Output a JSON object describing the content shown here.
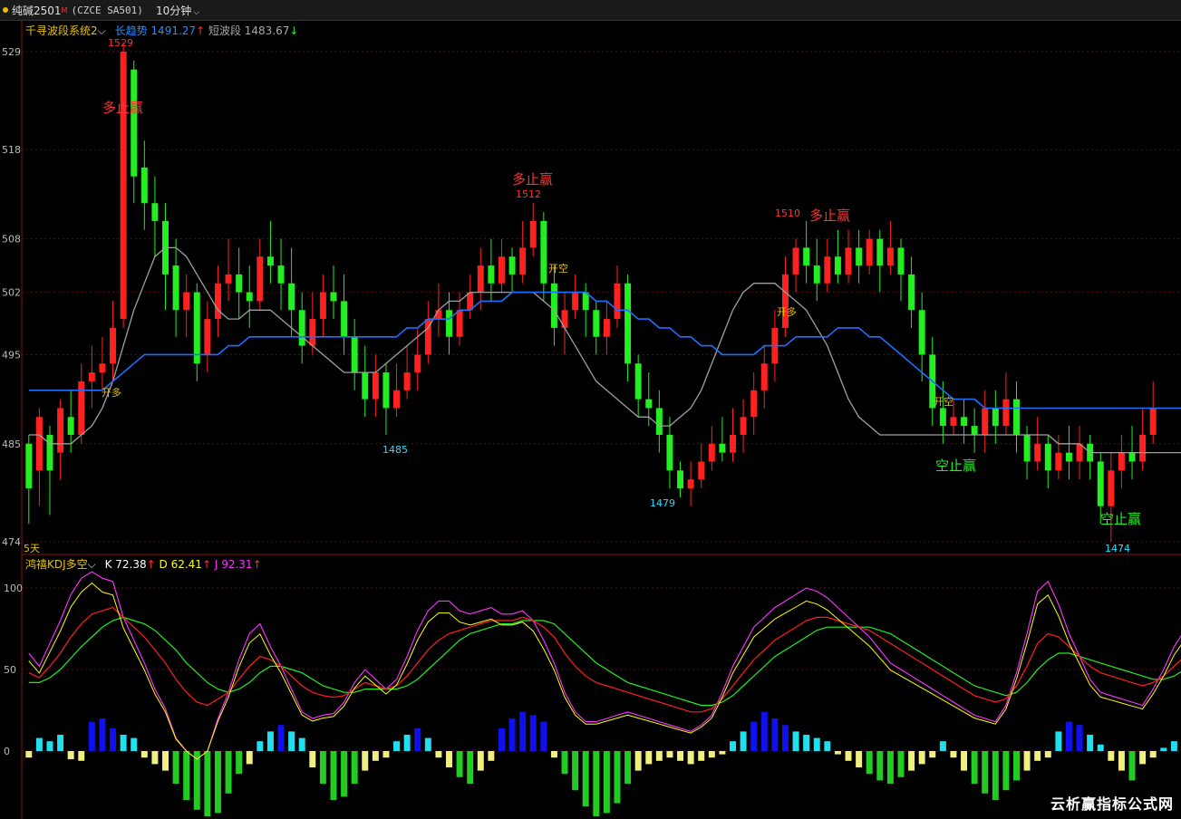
{
  "header": {
    "symbol": "纯碱2501",
    "marker": "M",
    "code": "(CZCE SA501)",
    "period": "10分钟"
  },
  "main_legend": {
    "system": "千寻波段系统2",
    "long_label": "长趋势",
    "long_value": "1491.27",
    "long_arrow": "↑",
    "short_label": "短波段",
    "short_value": "1483.67",
    "short_arrow": "↓"
  },
  "price_ticks": [
    "529",
    "518",
    "508",
    "502",
    "495",
    "485",
    "474"
  ],
  "bottom_left_label": "5天",
  "kdj_legend": {
    "name": "鸿禧KDJ多空",
    "k": "K 72.38",
    "k_arrow": "↑",
    "d": "D 62.41",
    "d_arrow": "↑",
    "j": "J 92.31",
    "j_arrow": "↑"
  },
  "kdj_ticks": [
    "100",
    "50",
    "0"
  ],
  "annotations": {
    "labels_red": [
      "多止赢",
      "多止赢",
      "多止赢"
    ],
    "labels_green": [
      "空止赢",
      "空止赢"
    ],
    "open_long": [
      "开多",
      "开多"
    ],
    "open_short": [
      "开空",
      "开空"
    ],
    "price_marks": [
      "1529",
      "1512",
      "1510",
      "1485",
      "1479",
      "1474"
    ]
  },
  "watermark": "云析赢指标公式网",
  "colors": {
    "up": "#ff2020",
    "down": "#22ee22",
    "long_trend": "#1e6fff",
    "short_wave": "#a0a0a0",
    "k": "#ffffff",
    "d": "#ffff00",
    "j": "#ff33ff"
  },
  "chart_data": {
    "type": "candlestick",
    "price_range": [
      1474,
      1529
    ],
    "kdj_range": [
      0,
      100
    ],
    "candles": [
      [
        1485,
        1480,
        1486,
        1476
      ],
      [
        1482,
        1488,
        1489,
        1478
      ],
      [
        1486,
        1482,
        1487,
        1477
      ],
      [
        1484,
        1489,
        1490,
        1481
      ],
      [
        1488,
        1486,
        1491,
        1484
      ],
      [
        1486,
        1492,
        1494,
        1485
      ],
      [
        1492,
        1493,
        1496,
        1489
      ],
      [
        1493,
        1494,
        1497,
        1491
      ],
      [
        1494,
        1498,
        1501,
        1492
      ],
      [
        1499,
        1529,
        1530,
        1498
      ],
      [
        1527,
        1515,
        1528,
        1512
      ],
      [
        1516,
        1512,
        1519,
        1509
      ],
      [
        1512,
        1510,
        1515,
        1506
      ],
      [
        1510,
        1504,
        1512,
        1500
      ],
      [
        1505,
        1500,
        1508,
        1497
      ],
      [
        1500,
        1502,
        1504,
        1497
      ],
      [
        1502,
        1494,
        1503,
        1492
      ],
      [
        1495,
        1499,
        1501,
        1493
      ],
      [
        1499,
        1503,
        1505,
        1497
      ],
      [
        1503,
        1504,
        1508,
        1501
      ],
      [
        1504,
        1502,
        1507,
        1499
      ],
      [
        1502,
        1501,
        1505,
        1498
      ],
      [
        1501,
        1506,
        1508,
        1500
      ],
      [
        1506,
        1505,
        1510,
        1503
      ],
      [
        1505,
        1503,
        1508,
        1500
      ],
      [
        1503,
        1500,
        1507,
        1497
      ],
      [
        1500,
        1496,
        1502,
        1494
      ],
      [
        1496,
        1499,
        1502,
        1495
      ],
      [
        1499,
        1502,
        1504,
        1497
      ],
      [
        1502,
        1501,
        1505,
        1499
      ],
      [
        1501,
        1497,
        1504,
        1495
      ],
      [
        1497,
        1493,
        1499,
        1491
      ],
      [
        1493,
        1490,
        1496,
        1488
      ],
      [
        1490,
        1493,
        1495,
        1488
      ],
      [
        1493,
        1489,
        1494,
        1486
      ],
      [
        1489,
        1491,
        1494,
        1488
      ],
      [
        1491,
        1493,
        1496,
        1490
      ],
      [
        1493,
        1495,
        1498,
        1491
      ],
      [
        1495,
        1499,
        1501,
        1494
      ],
      [
        1499,
        1500,
        1503,
        1497
      ],
      [
        1500,
        1497,
        1502,
        1495
      ],
      [
        1497,
        1500,
        1502,
        1496
      ],
      [
        1500,
        1502,
        1504,
        1499
      ],
      [
        1502,
        1505,
        1507,
        1500
      ],
      [
        1505,
        1503,
        1508,
        1501
      ],
      [
        1503,
        1506,
        1508,
        1502
      ],
      [
        1506,
        1504,
        1507,
        1502
      ],
      [
        1504,
        1507,
        1510,
        1503
      ],
      [
        1507,
        1510,
        1512,
        1506
      ],
      [
        1510,
        1503,
        1511,
        1501
      ],
      [
        1503,
        1498,
        1505,
        1496
      ],
      [
        1498,
        1500,
        1502,
        1495
      ],
      [
        1500,
        1502,
        1504,
        1499
      ],
      [
        1502,
        1500,
        1503,
        1497
      ],
      [
        1500,
        1497,
        1501,
        1495
      ],
      [
        1497,
        1499,
        1501,
        1495
      ],
      [
        1499,
        1503,
        1505,
        1498
      ],
      [
        1503,
        1494,
        1504,
        1492
      ],
      [
        1494,
        1490,
        1495,
        1488
      ],
      [
        1490,
        1489,
        1493,
        1487
      ],
      [
        1489,
        1486,
        1491,
        1484
      ],
      [
        1486,
        1482,
        1488,
        1480
      ],
      [
        1482,
        1480,
        1483,
        1479
      ],
      [
        1480,
        1481,
        1483,
        1478
      ],
      [
        1481,
        1483,
        1485,
        1480
      ],
      [
        1483,
        1485,
        1487,
        1482
      ],
      [
        1485,
        1484,
        1488,
        1483
      ],
      [
        1484,
        1486,
        1489,
        1483
      ],
      [
        1486,
        1488,
        1490,
        1484
      ],
      [
        1488,
        1491,
        1493,
        1486
      ],
      [
        1491,
        1494,
        1496,
        1489
      ],
      [
        1494,
        1498,
        1500,
        1492
      ],
      [
        1498,
        1504,
        1506,
        1497
      ],
      [
        1504,
        1507,
        1508,
        1502
      ],
      [
        1507,
        1505,
        1510,
        1503
      ],
      [
        1505,
        1503,
        1508,
        1501
      ],
      [
        1503,
        1506,
        1508,
        1502
      ],
      [
        1506,
        1504,
        1509,
        1503
      ],
      [
        1504,
        1507,
        1509,
        1503
      ],
      [
        1507,
        1505,
        1509,
        1503
      ],
      [
        1505,
        1508,
        1509,
        1504
      ],
      [
        1508,
        1505,
        1509,
        1502
      ],
      [
        1505,
        1507,
        1510,
        1504
      ],
      [
        1507,
        1504,
        1508,
        1501
      ],
      [
        1504,
        1500,
        1506,
        1498
      ],
      [
        1500,
        1495,
        1502,
        1492
      ],
      [
        1495,
        1489,
        1497,
        1487
      ],
      [
        1489,
        1487,
        1492,
        1485
      ],
      [
        1487,
        1488,
        1490,
        1486
      ],
      [
        1488,
        1487,
        1490,
        1485
      ],
      [
        1487,
        1486,
        1489,
        1484
      ],
      [
        1486,
        1489,
        1491,
        1484
      ],
      [
        1489,
        1487,
        1491,
        1485
      ],
      [
        1487,
        1490,
        1493,
        1486
      ],
      [
        1490,
        1486,
        1492,
        1484
      ],
      [
        1486,
        1483,
        1487,
        1481
      ],
      [
        1483,
        1485,
        1488,
        1482
      ],
      [
        1485,
        1482,
        1486,
        1480
      ],
      [
        1482,
        1484,
        1486,
        1481
      ],
      [
        1484,
        1483,
        1487,
        1481
      ],
      [
        1483,
        1485,
        1487,
        1481
      ],
      [
        1485,
        1483,
        1486,
        1481
      ],
      [
        1483,
        1478,
        1484,
        1476
      ],
      [
        1478,
        1482,
        1484,
        1474
      ],
      [
        1482,
        1484,
        1486,
        1480
      ],
      [
        1484,
        1483,
        1487,
        1481
      ],
      [
        1483,
        1486,
        1489,
        1482
      ],
      [
        1486,
        1489,
        1492,
        1485
      ]
    ],
    "k": [
      48,
      45,
      52,
      60,
      70,
      78,
      84,
      86,
      88,
      82,
      76,
      70,
      62,
      54,
      44,
      36,
      30,
      28,
      32,
      36,
      44,
      52,
      58,
      56,
      52,
      46,
      40,
      36,
      34,
      33,
      34,
      38,
      42,
      40,
      38,
      40,
      46,
      54,
      62,
      68,
      72,
      74,
      76,
      78,
      80,
      80,
      80,
      82,
      80,
      76,
      70,
      60,
      52,
      46,
      42,
      40,
      38,
      36,
      34,
      32,
      30,
      28,
      26,
      24,
      24,
      26,
      32,
      40,
      48,
      56,
      62,
      68,
      72,
      76,
      80,
      82,
      82,
      80,
      78,
      76,
      74,
      70,
      66,
      62,
      58,
      54,
      50,
      46,
      42,
      38,
      34,
      32,
      30,
      32,
      40,
      52,
      66,
      72,
      70,
      64,
      58,
      52,
      48,
      46,
      44,
      42,
      40,
      42,
      46,
      52,
      58,
      64,
      70,
      72
    ],
    "d": [
      42,
      42,
      45,
      50,
      57,
      64,
      70,
      76,
      80,
      82,
      80,
      78,
      74,
      68,
      62,
      54,
      48,
      42,
      38,
      36,
      38,
      42,
      48,
      52,
      52,
      50,
      48,
      44,
      40,
      38,
      36,
      36,
      38,
      38,
      38,
      38,
      40,
      44,
      50,
      56,
      62,
      68,
      72,
      74,
      76,
      78,
      78,
      80,
      80,
      80,
      78,
      72,
      66,
      60,
      54,
      50,
      46,
      42,
      40,
      38,
      36,
      34,
      32,
      30,
      28,
      28,
      30,
      34,
      40,
      46,
      52,
      58,
      62,
      66,
      70,
      74,
      76,
      76,
      76,
      76,
      76,
      74,
      72,
      68,
      64,
      60,
      56,
      52,
      48,
      44,
      40,
      38,
      36,
      34,
      36,
      42,
      50,
      56,
      60,
      60,
      58,
      56,
      54,
      52,
      50,
      48,
      46,
      44,
      44,
      46,
      50,
      54,
      58,
      62
    ],
    "j": [
      60,
      52,
      66,
      80,
      96,
      106,
      112,
      106,
      104,
      82,
      68,
      54,
      38,
      26,
      8,
      0,
      -6,
      0,
      20,
      36,
      56,
      72,
      78,
      64,
      52,
      38,
      24,
      20,
      22,
      23,
      30,
      42,
      50,
      44,
      38,
      44,
      58,
      74,
      86,
      92,
      92,
      86,
      84,
      86,
      88,
      84,
      84,
      86,
      80,
      68,
      54,
      36,
      24,
      18,
      18,
      20,
      22,
      24,
      22,
      20,
      18,
      16,
      14,
      12,
      16,
      22,
      36,
      52,
      64,
      76,
      82,
      88,
      92,
      96,
      100,
      98,
      94,
      88,
      82,
      76,
      70,
      62,
      54,
      50,
      46,
      42,
      38,
      34,
      30,
      26,
      22,
      20,
      18,
      28,
      48,
      72,
      98,
      104,
      90,
      72,
      58,
      44,
      36,
      34,
      32,
      30,
      28,
      38,
      50,
      64,
      74,
      84,
      94,
      92
    ],
    "hist": [
      -4,
      8,
      6,
      10,
      -5,
      -6,
      18,
      20,
      14,
      10,
      8,
      -4,
      -8,
      -12,
      -20,
      -30,
      -36,
      -40,
      -38,
      -26,
      -14,
      -8,
      6,
      12,
      16,
      12,
      8,
      -10,
      -20,
      -30,
      -28,
      -20,
      -12,
      -6,
      -4,
      6,
      10,
      14,
      8,
      -4,
      -10,
      -16,
      -20,
      -12,
      -6,
      14,
      20,
      24,
      22,
      18,
      -4,
      -14,
      -24,
      -34,
      -40,
      -38,
      -32,
      -20,
      -12,
      -8,
      -6,
      -4,
      -6,
      -8,
      -6,
      -4,
      -2,
      6,
      12,
      18,
      24,
      20,
      16,
      12,
      10,
      8,
      6,
      -2,
      -6,
      -10,
      -14,
      -18,
      -20,
      -16,
      -12,
      -8,
      -4,
      6,
      -4,
      -12,
      -20,
      -26,
      -30,
      -24,
      -18,
      -12,
      -6,
      -4,
      12,
      18,
      16,
      10,
      4,
      -6,
      -12,
      -18,
      -8,
      -4,
      2,
      6,
      10,
      12,
      14,
      10,
      8
    ],
    "long_trend": [
      1491,
      1491,
      1491,
      1491,
      1491,
      1491,
      1491,
      1491,
      1492,
      1493,
      1494,
      1495,
      1495,
      1495,
      1495,
      1495,
      1495,
      1495,
      1495,
      1496,
      1496,
      1497,
      1497,
      1497,
      1497,
      1497,
      1497,
      1497,
      1497,
      1497,
      1497,
      1497,
      1497,
      1497,
      1497,
      1497,
      1498,
      1498,
      1499,
      1499,
      1499,
      1500,
      1500,
      1501,
      1501,
      1501,
      1502,
      1502,
      1502,
      1502,
      1502,
      1502,
      1502,
      1502,
      1501,
      1501,
      1500,
      1500,
      1499,
      1499,
      1498,
      1498,
      1497,
      1497,
      1496,
      1496,
      1495,
      1495,
      1495,
      1495,
      1496,
      1496,
      1496,
      1497,
      1497,
      1497,
      1497,
      1498,
      1498,
      1498,
      1497,
      1497,
      1496,
      1495,
      1494,
      1493,
      1492,
      1491,
      1490,
      1490,
      1490,
      1489,
      1489,
      1489,
      1489,
      1489,
      1489,
      1489,
      1489,
      1489,
      1489,
      1489,
      1489,
      1489,
      1489,
      1489,
      1489,
      1489,
      1489,
      1489,
      1489,
      1489
    ],
    "short_wave": [
      1486,
      1486,
      1485,
      1485,
      1485,
      1486,
      1487,
      1489,
      1492,
      1496,
      1500,
      1503,
      1506,
      1507,
      1507,
      1506,
      1504,
      1502,
      1500,
      1499,
      1499,
      1500,
      1500,
      1500,
      1499,
      1498,
      1497,
      1496,
      1495,
      1494,
      1493,
      1493,
      1493,
      1493,
      1494,
      1495,
      1496,
      1497,
      1498,
      1500,
      1501,
      1501,
      1502,
      1502,
      1502,
      1502,
      1502,
      1502,
      1502,
      1501,
      1500,
      1498,
      1496,
      1494,
      1492,
      1491,
      1490,
      1489,
      1488,
      1488,
      1487,
      1487,
      1488,
      1489,
      1491,
      1494,
      1497,
      1500,
      1502,
      1503,
      1503,
      1503,
      1502,
      1501,
      1500,
      1498,
      1496,
      1493,
      1490,
      1488,
      1487,
      1486,
      1486,
      1486,
      1486,
      1486,
      1486,
      1486,
      1486,
      1486,
      1486,
      1486,
      1486,
      1486,
      1486,
      1486,
      1486,
      1486,
      1485,
      1485,
      1485,
      1484,
      1484,
      1484,
      1484,
      1484,
      1484,
      1484,
      1484,
      1484,
      1484,
      1484
    ]
  }
}
